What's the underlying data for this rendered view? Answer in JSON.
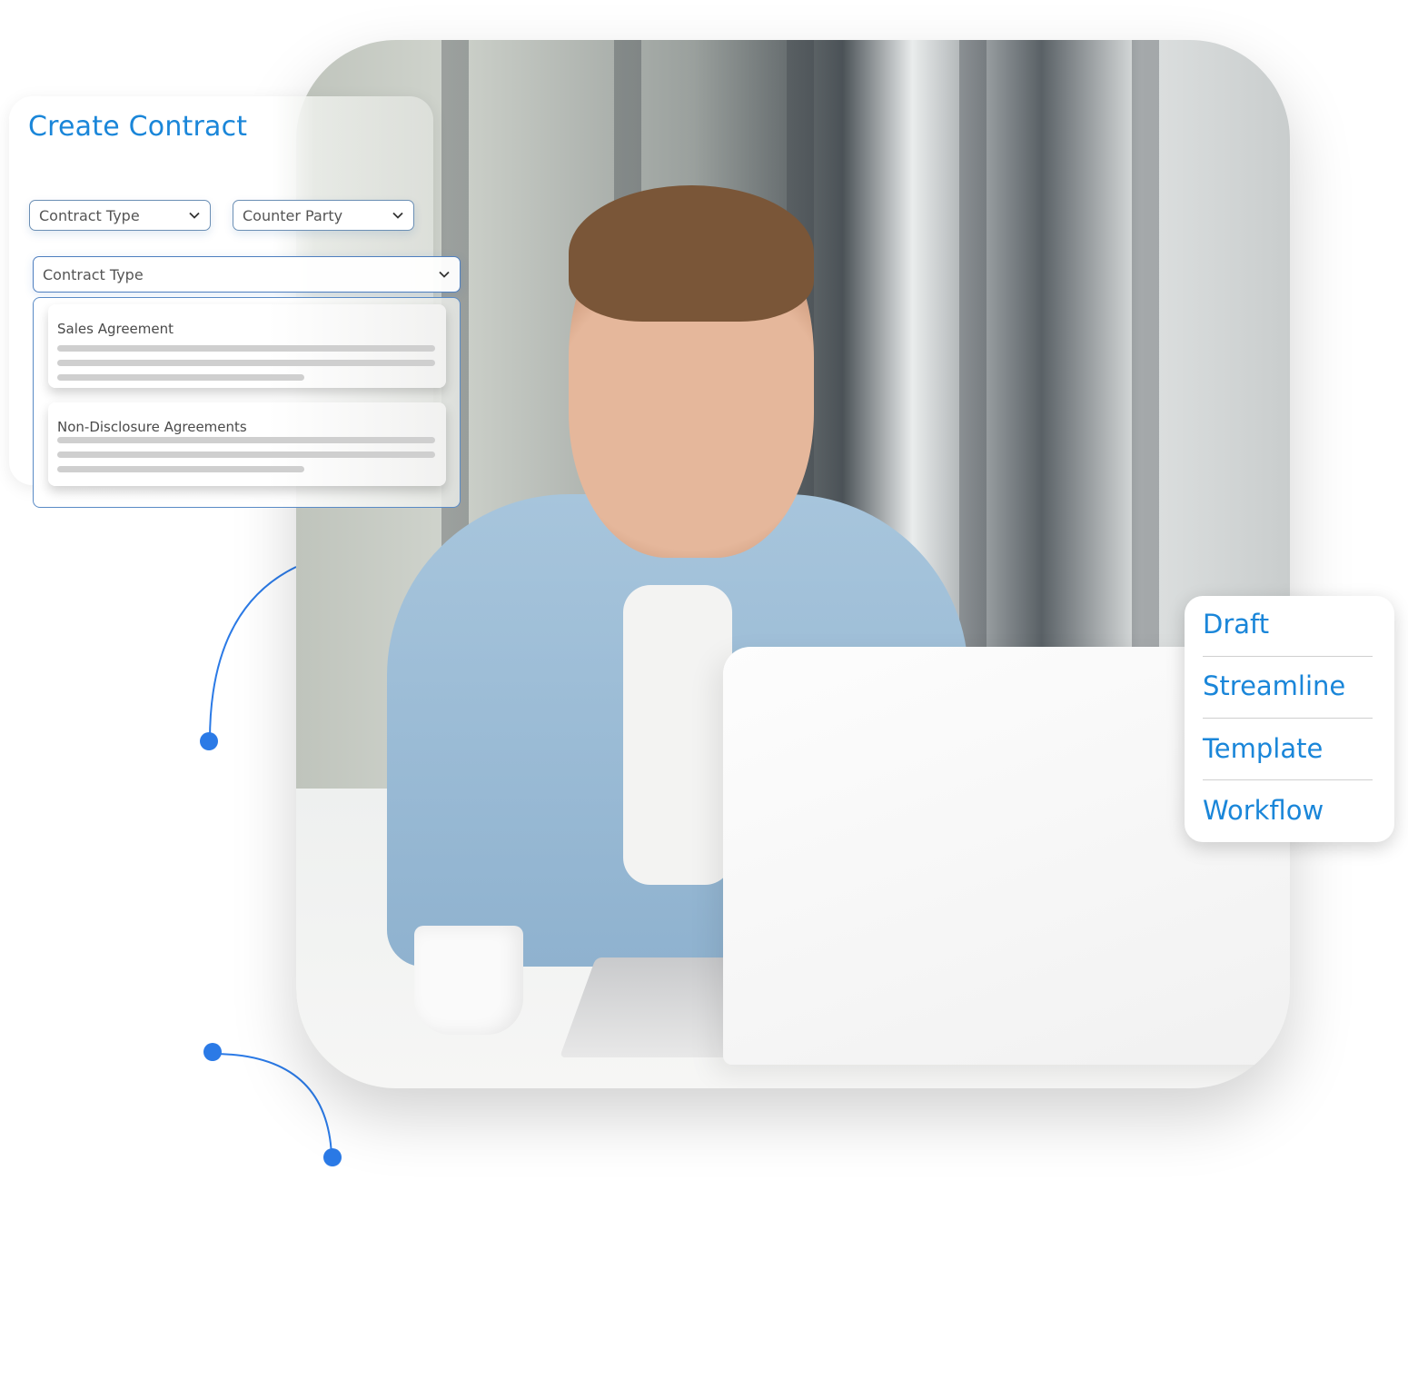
{
  "card": {
    "title": "Create Contract",
    "contract_type_select": {
      "label": "Contract Type",
      "icon": "chevron-down-icon"
    },
    "counter_party_select": {
      "label": "Counter Party",
      "icon": "chevron-down-icon"
    },
    "expanded_select": {
      "label": "Contract Type",
      "icon": "chevron-down-icon",
      "options": [
        {
          "title": "Sales Agreement"
        },
        {
          "title": "Non-Disclosure Agreements"
        }
      ]
    }
  },
  "menu": {
    "items": [
      {
        "label": "Draft"
      },
      {
        "label": "Streamline"
      },
      {
        "label": "Template"
      },
      {
        "label": "Workflow"
      }
    ]
  },
  "colors": {
    "accent": "#1a86d9",
    "connector": "#2b7ae6",
    "grid_line": "#c9d6ef"
  }
}
